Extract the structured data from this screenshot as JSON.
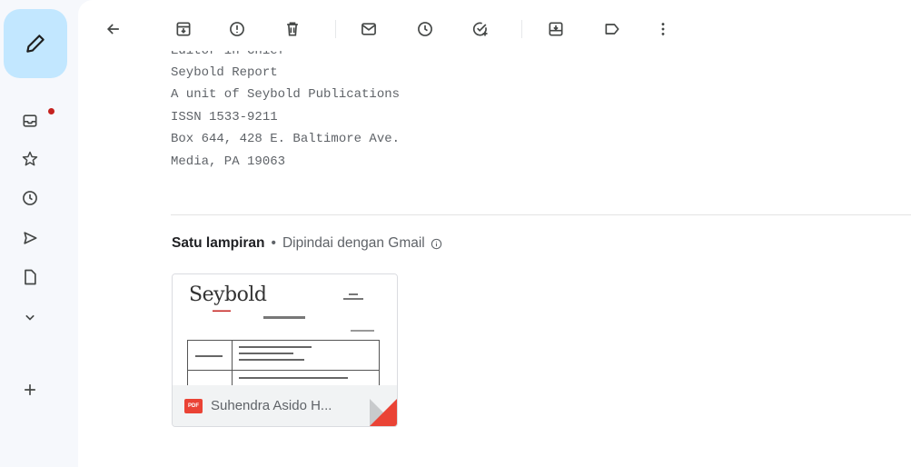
{
  "rail": {
    "items": [
      {
        "icon": "inbox-icon"
      },
      {
        "icon": "star-icon"
      },
      {
        "icon": "clock-icon"
      },
      {
        "icon": "send-icon"
      },
      {
        "icon": "draft-icon"
      },
      {
        "icon": "chevron-down-icon"
      },
      {
        "icon": "plus-icon"
      }
    ],
    "accent": "#c2e7ff",
    "badge_color": "#c5221f"
  },
  "toolbar": {
    "buttons": [
      "back-icon",
      "archive-icon",
      "report-spam-icon",
      "delete-icon",
      "mark-unread-icon",
      "snooze-icon",
      "add-to-tasks-icon",
      "move-to-icon",
      "label-icon",
      "more-icon"
    ]
  },
  "signature": {
    "cut_line": "Editor in Chief",
    "lines": [
      "Seybold Report",
      "A unit of Seybold Publications",
      "ISSN 1533-9211",
      "Box 644, 428 E. Baltimore Ave.",
      "Media, PA 19063"
    ]
  },
  "attachments": {
    "count_label": "Satu lampiran",
    "separator": "•",
    "scanned_label": "Dipindai dengan Gmail",
    "items": [
      {
        "name": "Suhendra Asido H...",
        "badge": "PDF",
        "preview_logo": "Seybold"
      }
    ]
  }
}
